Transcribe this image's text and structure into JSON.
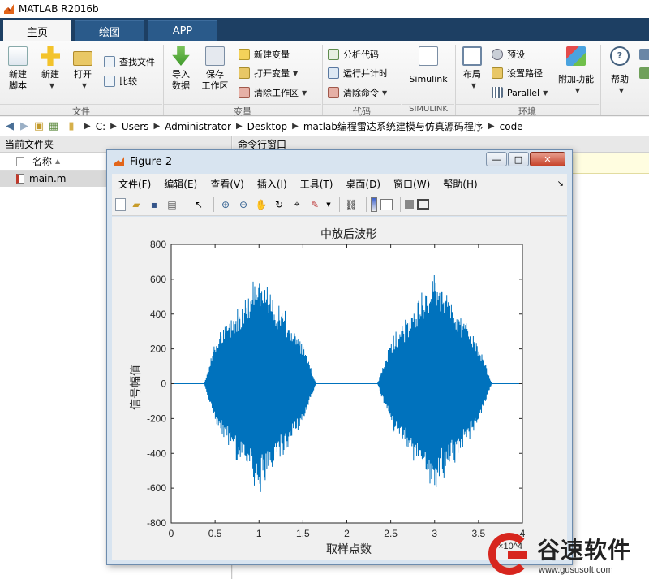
{
  "app": {
    "title": "MATLAB R2016b"
  },
  "tabs": [
    {
      "label": "主页"
    },
    {
      "label": "绘图"
    },
    {
      "label": "APP"
    }
  ],
  "ribbon": {
    "file": {
      "new_script": "新建\n脚本",
      "new": "新建",
      "open": "打开",
      "find_files": "查找文件",
      "compare": "比较",
      "section": "文件"
    },
    "variable": {
      "import_data": "导入\n数据",
      "save_workspace": "保存\n工作区",
      "new_variable": "新建变量",
      "open_variable": "打开变量",
      "clear_workspace": "清除工作区",
      "section": "变量"
    },
    "code": {
      "analyze_code": "分析代码",
      "run_and_time": "运行并计时",
      "clear_commands": "清除命令",
      "section": "代码"
    },
    "simulink": {
      "label": "Simulink",
      "section": "SIMULINK"
    },
    "environment": {
      "layout": "布局",
      "preferences": "预设",
      "set_path": "设置路径",
      "parallel": "Parallel",
      "addons": "附加功能",
      "section": "环境"
    },
    "resources": {
      "help": "帮助"
    }
  },
  "address": {
    "crumbs": [
      "C:",
      "Users",
      "Administrator",
      "Desktop",
      "matlab编程雷达系统建模与仿真源码程序",
      "code"
    ]
  },
  "current_folder": {
    "title": "当前文件夹",
    "col_name": "名称",
    "sort_arrow": "▲",
    "files": [
      {
        "name": "main.m"
      }
    ]
  },
  "command_window": {
    "title": "命令行窗口"
  },
  "figure": {
    "title": "Figure 2",
    "menu": [
      "文件(F)",
      "编辑(E)",
      "查看(V)",
      "插入(I)",
      "工具(T)",
      "桌面(D)",
      "窗口(W)",
      "帮助(H)"
    ],
    "min_label": "—",
    "max_label": "□",
    "close_label": "✕",
    "toolbar_icons": [
      "new-figure-icon",
      "open-file-icon",
      "save-icon",
      "print-icon",
      "pointer-icon",
      "zoom-in-icon",
      "zoom-out-icon",
      "pan-icon",
      "rotate-icon",
      "data-cursor-icon",
      "brush-icon",
      "link-icon",
      "colorbar-icon",
      "legend-icon",
      "hide-plot-tools-icon",
      "show-plot-tools-icon"
    ]
  },
  "chart_data": {
    "type": "line",
    "title": "中放后波形",
    "xlabel": "取样点数",
    "ylabel": "信号幅值",
    "xlim": [
      0,
      4
    ],
    "ylim": [
      -800,
      800
    ],
    "xticks": [
      "0",
      "0.5",
      "1",
      "1.5",
      "2",
      "2.5",
      "3",
      "3.5",
      "4"
    ],
    "yticks": [
      "-800",
      "-600",
      "-400",
      "-200",
      "0",
      "200",
      "400",
      "600",
      "800"
    ],
    "x_scale_note": "×10^4",
    "grid": false,
    "color": "#0072bd",
    "series": [
      {
        "envelope": [
          {
            "x": 0,
            "y": 0
          },
          {
            "x": 0.38,
            "y": 0
          },
          {
            "x": 0.5,
            "y": 260
          },
          {
            "x": 0.75,
            "y": 460
          },
          {
            "x": 0.9,
            "y": 560
          },
          {
            "x": 1.0,
            "y": 710
          },
          {
            "x": 1.1,
            "y": 560
          },
          {
            "x": 1.3,
            "y": 420
          },
          {
            "x": 1.5,
            "y": 240
          },
          {
            "x": 1.65,
            "y": 0
          },
          {
            "x": 2.35,
            "y": 0
          },
          {
            "x": 2.5,
            "y": 260
          },
          {
            "x": 2.75,
            "y": 460
          },
          {
            "x": 2.9,
            "y": 560
          },
          {
            "x": 3.0,
            "y": 700
          },
          {
            "x": 3.1,
            "y": 560
          },
          {
            "x": 3.3,
            "y": 420
          },
          {
            "x": 3.5,
            "y": 240
          },
          {
            "x": 3.65,
            "y": 0
          },
          {
            "x": 4,
            "y": 0
          }
        ]
      }
    ]
  },
  "watermark": {
    "brand": "谷速软件",
    "url": "www.gususoft.com",
    "color": "#d7261e"
  }
}
